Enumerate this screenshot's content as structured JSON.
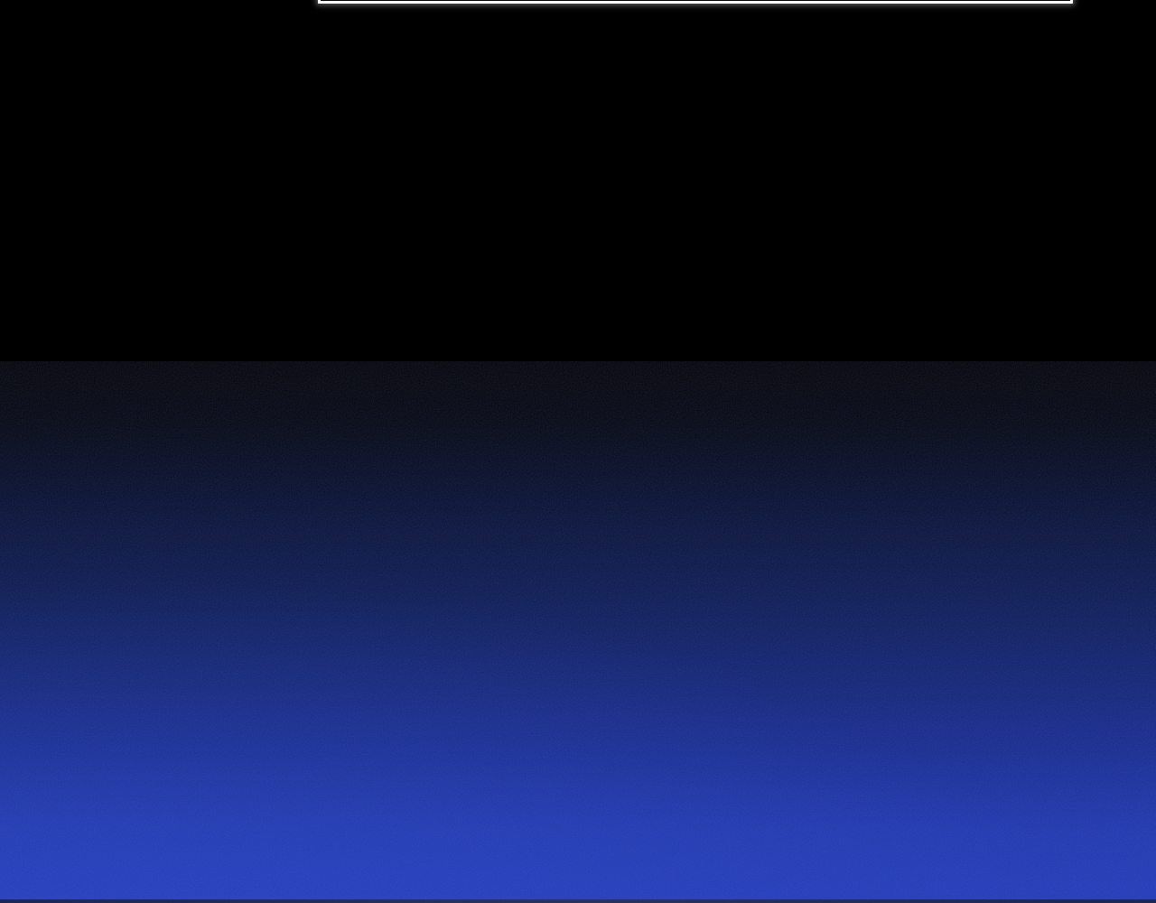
{
  "scene": {
    "colors": {
      "sky_top": "#000000",
      "sky_bottom": "#2038b8",
      "panel_border": "#ffffff"
    }
  }
}
